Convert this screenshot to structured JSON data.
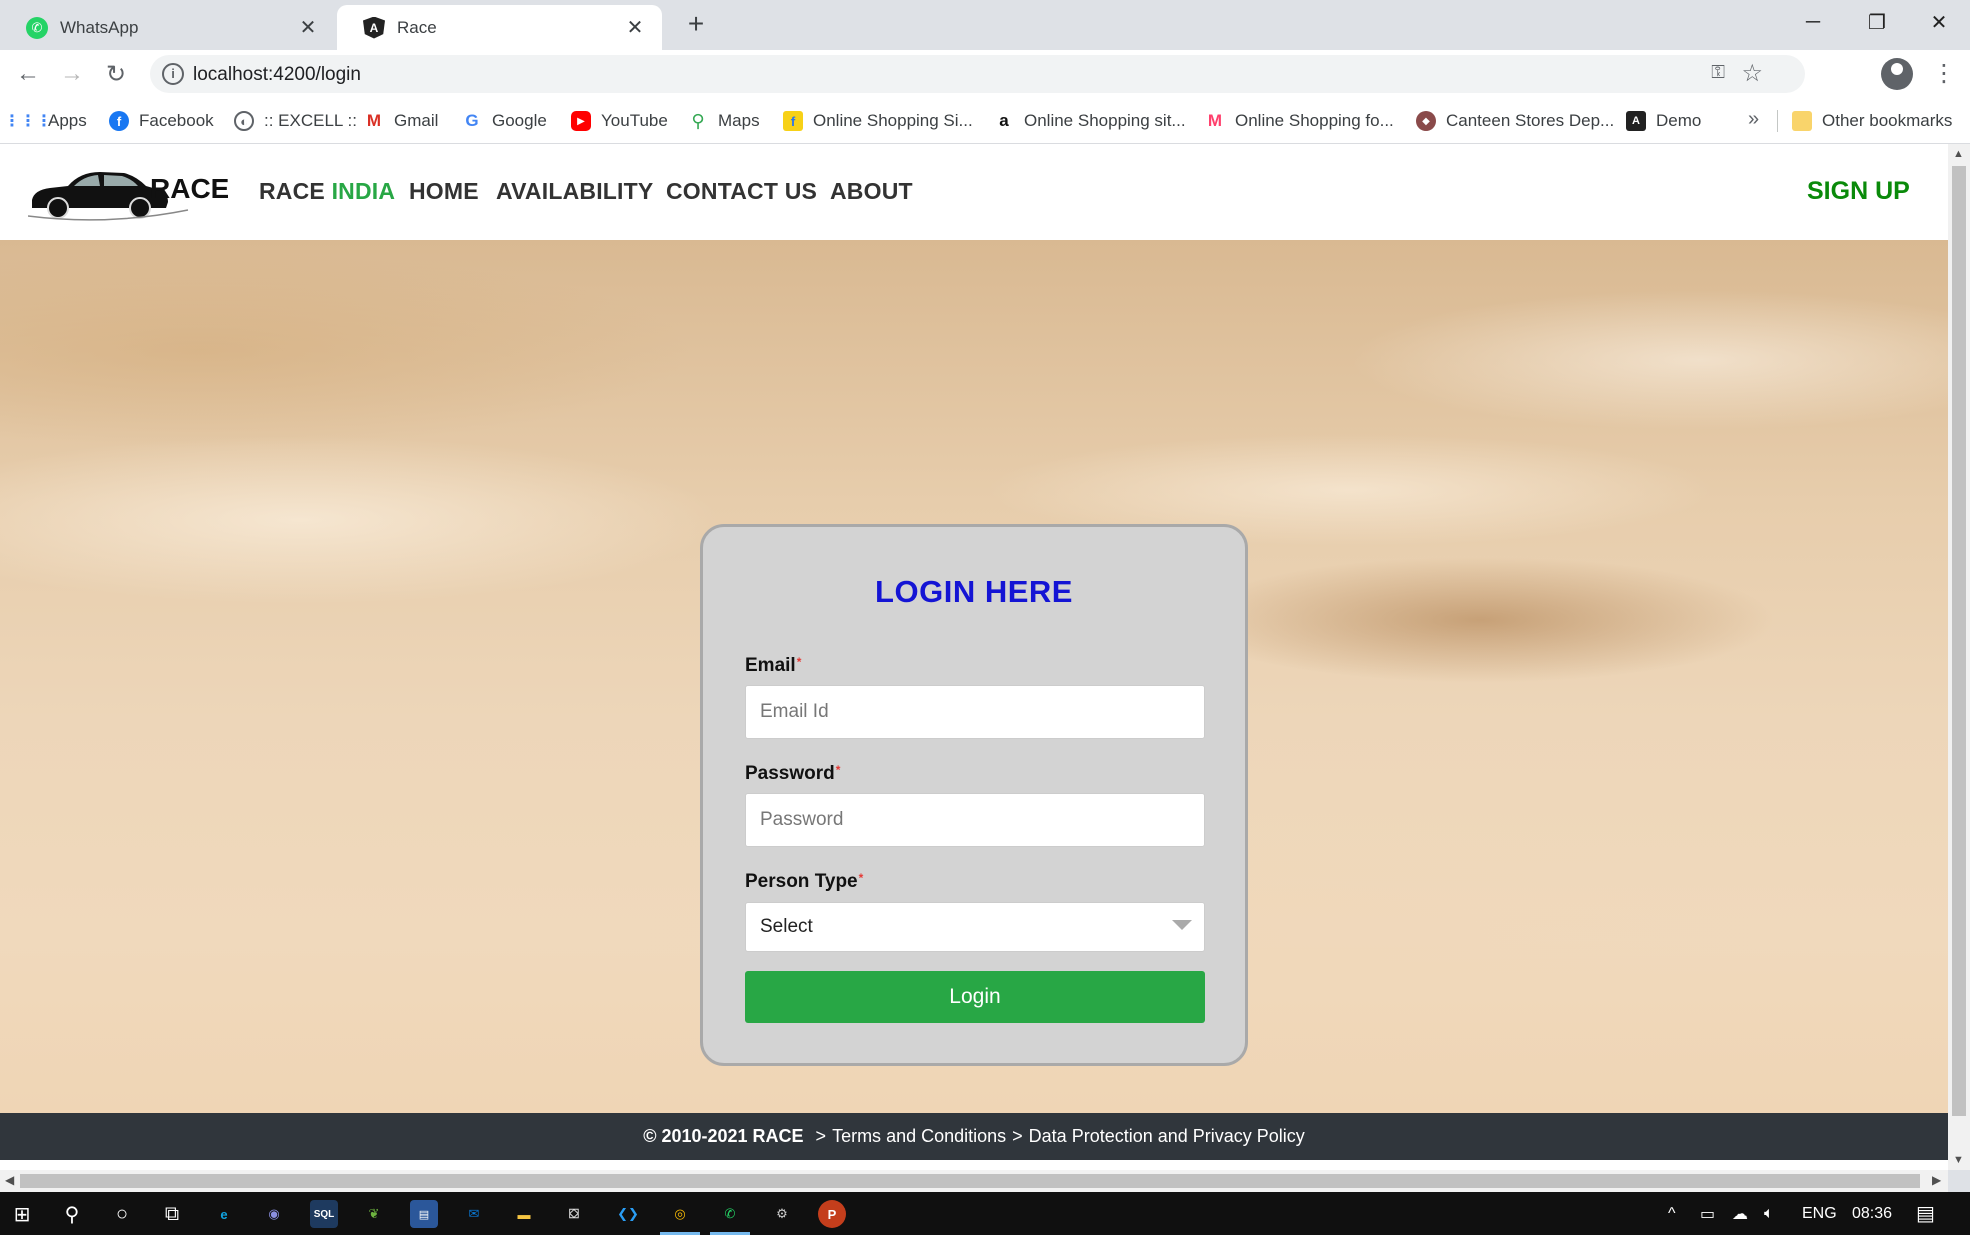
{
  "browser": {
    "tabs": [
      {
        "title": "WhatsApp",
        "active": false
      },
      {
        "title": "Race",
        "active": true
      }
    ],
    "url": "localhost:4200/login",
    "bookmarks": [
      {
        "label": "Apps",
        "icon": "apps-grid-icon"
      },
      {
        "label": "Facebook",
        "icon": "facebook-icon"
      },
      {
        "label": ":: EXCELL ::",
        "icon": "globe-icon"
      },
      {
        "label": "Gmail",
        "icon": "gmail-icon"
      },
      {
        "label": "Google",
        "icon": "google-icon"
      },
      {
        "label": "YouTube",
        "icon": "youtube-icon"
      },
      {
        "label": "Maps",
        "icon": "maps-pin-icon"
      },
      {
        "label": "Online Shopping Si...",
        "icon": "flipkart-icon"
      },
      {
        "label": "Online Shopping sit...",
        "icon": "amazon-icon"
      },
      {
        "label": "Online Shopping fo...",
        "icon": "myntra-icon"
      },
      {
        "label": "Canteen Stores Dep...",
        "icon": "csd-icon"
      },
      {
        "label": "Demo",
        "icon": "angular-icon"
      }
    ],
    "other_bookmarks": "Other bookmarks"
  },
  "site": {
    "logo_text": "RACE",
    "nav": {
      "brand_main": "RACE",
      "brand_accent": "INDIA",
      "home": "HOME",
      "availability": "AVAILABILITY",
      "contact": "CONTACT US",
      "about": "ABOUT",
      "signup": "SIGN UP"
    },
    "login": {
      "title": "LOGIN HERE",
      "email_label": "Email",
      "email_placeholder": "Email Id",
      "password_label": "Password",
      "password_placeholder": "Password",
      "person_type_label": "Person Type",
      "person_type_selected": "Select",
      "required_mark": "*",
      "button": "Login"
    },
    "footer": {
      "copyright": "© 2010-2021 RACE",
      "sep": ">",
      "terms": "Terms and Conditions",
      "privacy": "Data Protection and Privacy Policy"
    }
  },
  "taskbar": {
    "language": "ENG",
    "time": "08:36"
  },
  "colors": {
    "brand_green": "#28a745",
    "signup_green": "#0a8a0a",
    "login_title_blue": "#1414d4",
    "footer_bg": "#30363c",
    "card_bg": "#d3d3d3"
  }
}
